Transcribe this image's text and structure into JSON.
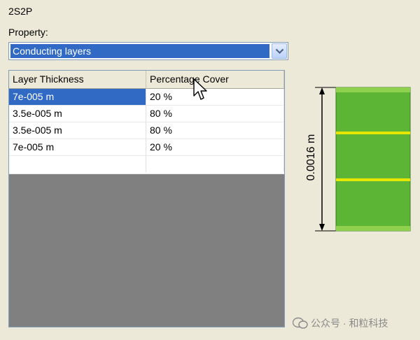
{
  "panel": {
    "title": "2S2P"
  },
  "property": {
    "label": "Property:",
    "selected": "Conducting layers",
    "dropdown_icon": "chevron-down-icon"
  },
  "table": {
    "columns": [
      "Layer Thickness",
      "Percentage Cover"
    ],
    "rows": [
      {
        "thickness": "7e-005 m",
        "cover": "20 %"
      },
      {
        "thickness": "3.5e-005 m",
        "cover": "80 %"
      },
      {
        "thickness": "3.5e-005 m",
        "cover": "80 %"
      },
      {
        "thickness": "7e-005 m",
        "cover": "20 %"
      }
    ]
  },
  "diagram": {
    "dimension_label": "0.0016 m",
    "board_color": "#5cb534",
    "layer_color": "#e6e600"
  },
  "watermark": {
    "text": "公众号 · 和粒科技"
  },
  "colors": {
    "selection": "#316ac5",
    "background": "#ece9d8",
    "empty_grid": "#808080"
  }
}
